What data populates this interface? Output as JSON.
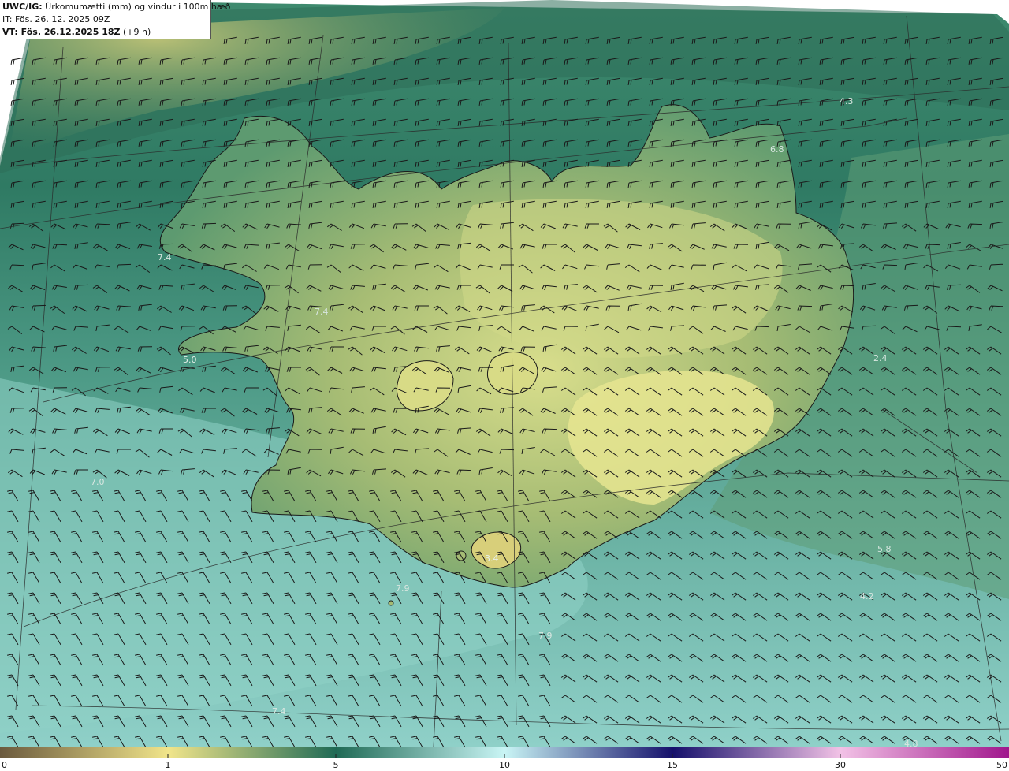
{
  "header": {
    "model_label": "UWC/IG:",
    "title": " Úrkomumætti (mm) og vindur i 100m hæð",
    "init_time": "IT: Fös. 26. 12. 2025 09Z",
    "valid_prefix": "VT: Fös. 26.12.2025 18Z",
    "valid_offset": " (+9 h)"
  },
  "colorbar": {
    "ticks": [
      "0",
      "1",
      "5",
      "10",
      "15",
      "30",
      "50"
    ],
    "colors": [
      "#6b5a3e",
      "#f1e58a",
      "#1f6a55",
      "#c9f5f5",
      "#15106b",
      "#f2c2e6",
      "#a0168c"
    ]
  },
  "map_labels": [
    {
      "text": "4.3",
      "color": "#d8e6e0"
    },
    {
      "text": "6.8",
      "color": "#d8e6e0"
    },
    {
      "text": "7.4",
      "color": "#d8e6e0"
    },
    {
      "text": "7.4",
      "color": "#d8e6e0"
    },
    {
      "text": "5.0",
      "color": "#e6efe9"
    },
    {
      "text": "7.0",
      "color": "#d8e6e0"
    },
    {
      "text": "3.4",
      "color": "#e6efe9"
    },
    {
      "text": "7.9",
      "color": "#d8e6e0"
    },
    {
      "text": "7.9",
      "color": "#d8e6e0"
    },
    {
      "text": "7.4",
      "color": "#d8e6e0"
    },
    {
      "text": "5.8",
      "color": "#d8e6e0"
    },
    {
      "text": "4.2",
      "color": "#d8e6e0"
    },
    {
      "text": "2.4",
      "color": "#d8e6e0"
    },
    {
      "text": "4.8",
      "color": "#d8e6e0"
    }
  ]
}
